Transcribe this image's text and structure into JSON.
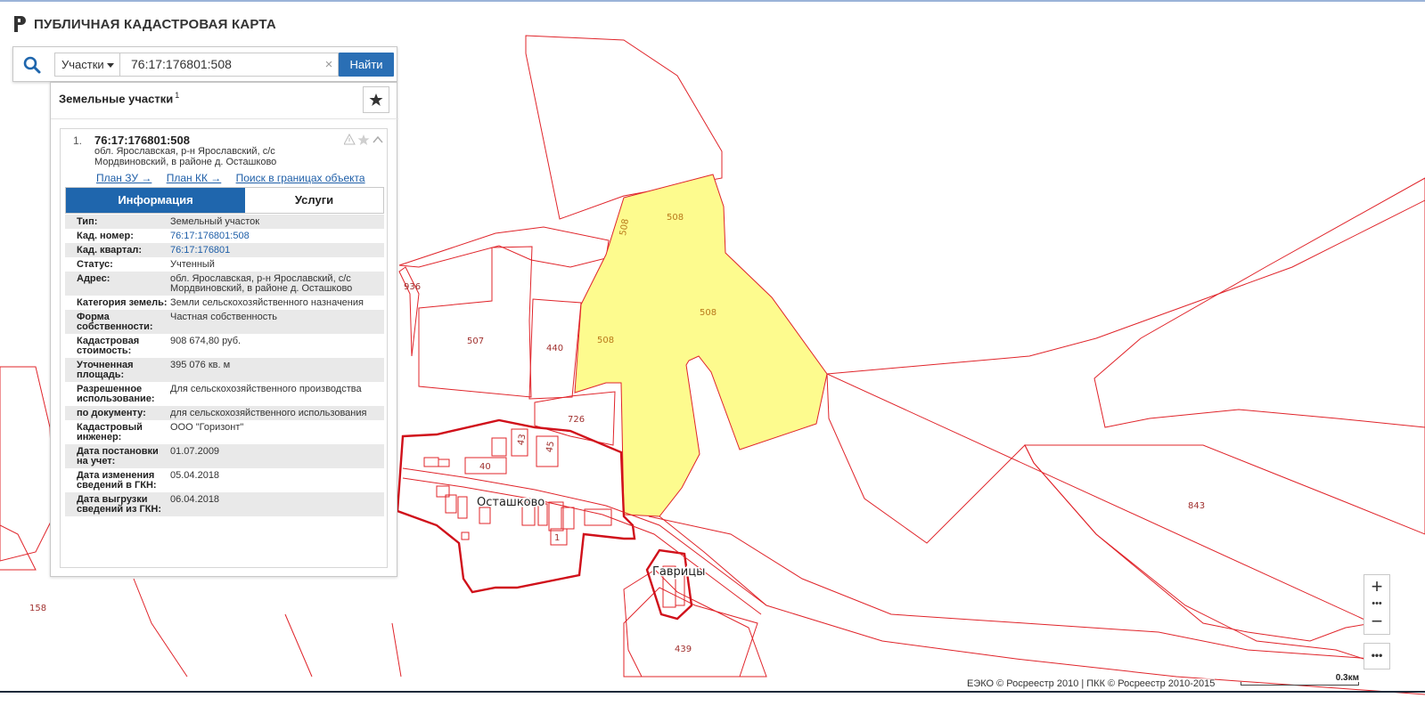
{
  "app": {
    "title": "ПУБЛИЧНАЯ КАДАСТРОВАЯ КАРТА"
  },
  "search": {
    "type_label": "Участки",
    "query": "76:17:176801:508",
    "clear": "×",
    "find_label": "Найти"
  },
  "results": {
    "title": "Земельные участки",
    "count": "1",
    "item": {
      "index": "1.",
      "cad_number": "76:17:176801:508",
      "address": "обл. Ярославская, р-н Ярославский, с/с Мордвиновский, в районе д. Осташково",
      "links": [
        "План ЗУ →",
        "План КК →",
        "Поиск в границах объекта →"
      ]
    },
    "tabs": [
      "Информация",
      "Услуги"
    ],
    "rows": [
      {
        "key": "Тип:",
        "value": "Земельный участок"
      },
      {
        "key": "Кад. номер:",
        "value": "76:17:176801:508",
        "link": true
      },
      {
        "key": "Кад. квартал:",
        "value": "76:17:176801",
        "link": true
      },
      {
        "key": "Статус:",
        "value": "Учтенный"
      },
      {
        "key": "Адрес:",
        "value": "обл. Ярославская, р-н Ярославский, с/с Мордвиновский, в районе д. Осташково"
      },
      {
        "key": "Категория земель:",
        "value": "Земли сельскохозяйственного назначения"
      },
      {
        "key": "Форма собственности:",
        "value": "Частная собственность"
      },
      {
        "key": "Кадастровая стоимость:",
        "value": "908 674,80 руб."
      },
      {
        "key": "Уточненная площадь:",
        "value": "395 076 кв. м"
      },
      {
        "key": "Разрешенное использование:",
        "value": "Для сельскохозяйственного производства"
      },
      {
        "key": "по документу:",
        "value": "для сельскохозяйственного использования"
      },
      {
        "key": "Кадастровый инженер:",
        "value": "ООО \"Горизонт\""
      },
      {
        "key": "Дата постановки на учет:",
        "value": "01.07.2009"
      },
      {
        "key": "Дата изменения сведений в ГКН:",
        "value": "05.04.2018"
      },
      {
        "key": "Дата выгрузки сведений из ГКН:",
        "value": "06.04.2018"
      }
    ]
  },
  "map": {
    "places": [
      "Осташково",
      "Гаврицы"
    ],
    "parcel_labels": [
      "508",
      "508",
      "508",
      "508",
      "936",
      "507",
      "440",
      "726",
      "40",
      "43",
      "45",
      "843",
      "439",
      "158",
      "1"
    ],
    "selected_fill": "#fdfb8e",
    "border_color": "#e0242a"
  },
  "controls": {
    "zoom_in": "+",
    "zoom_dots": "•••",
    "zoom_out": "−",
    "more": "•••"
  },
  "footer": {
    "copyright": "ЕЭКО © Росреестр 2010 | ПКК © Росреестр 2010-2015",
    "scale": "0.3км"
  }
}
